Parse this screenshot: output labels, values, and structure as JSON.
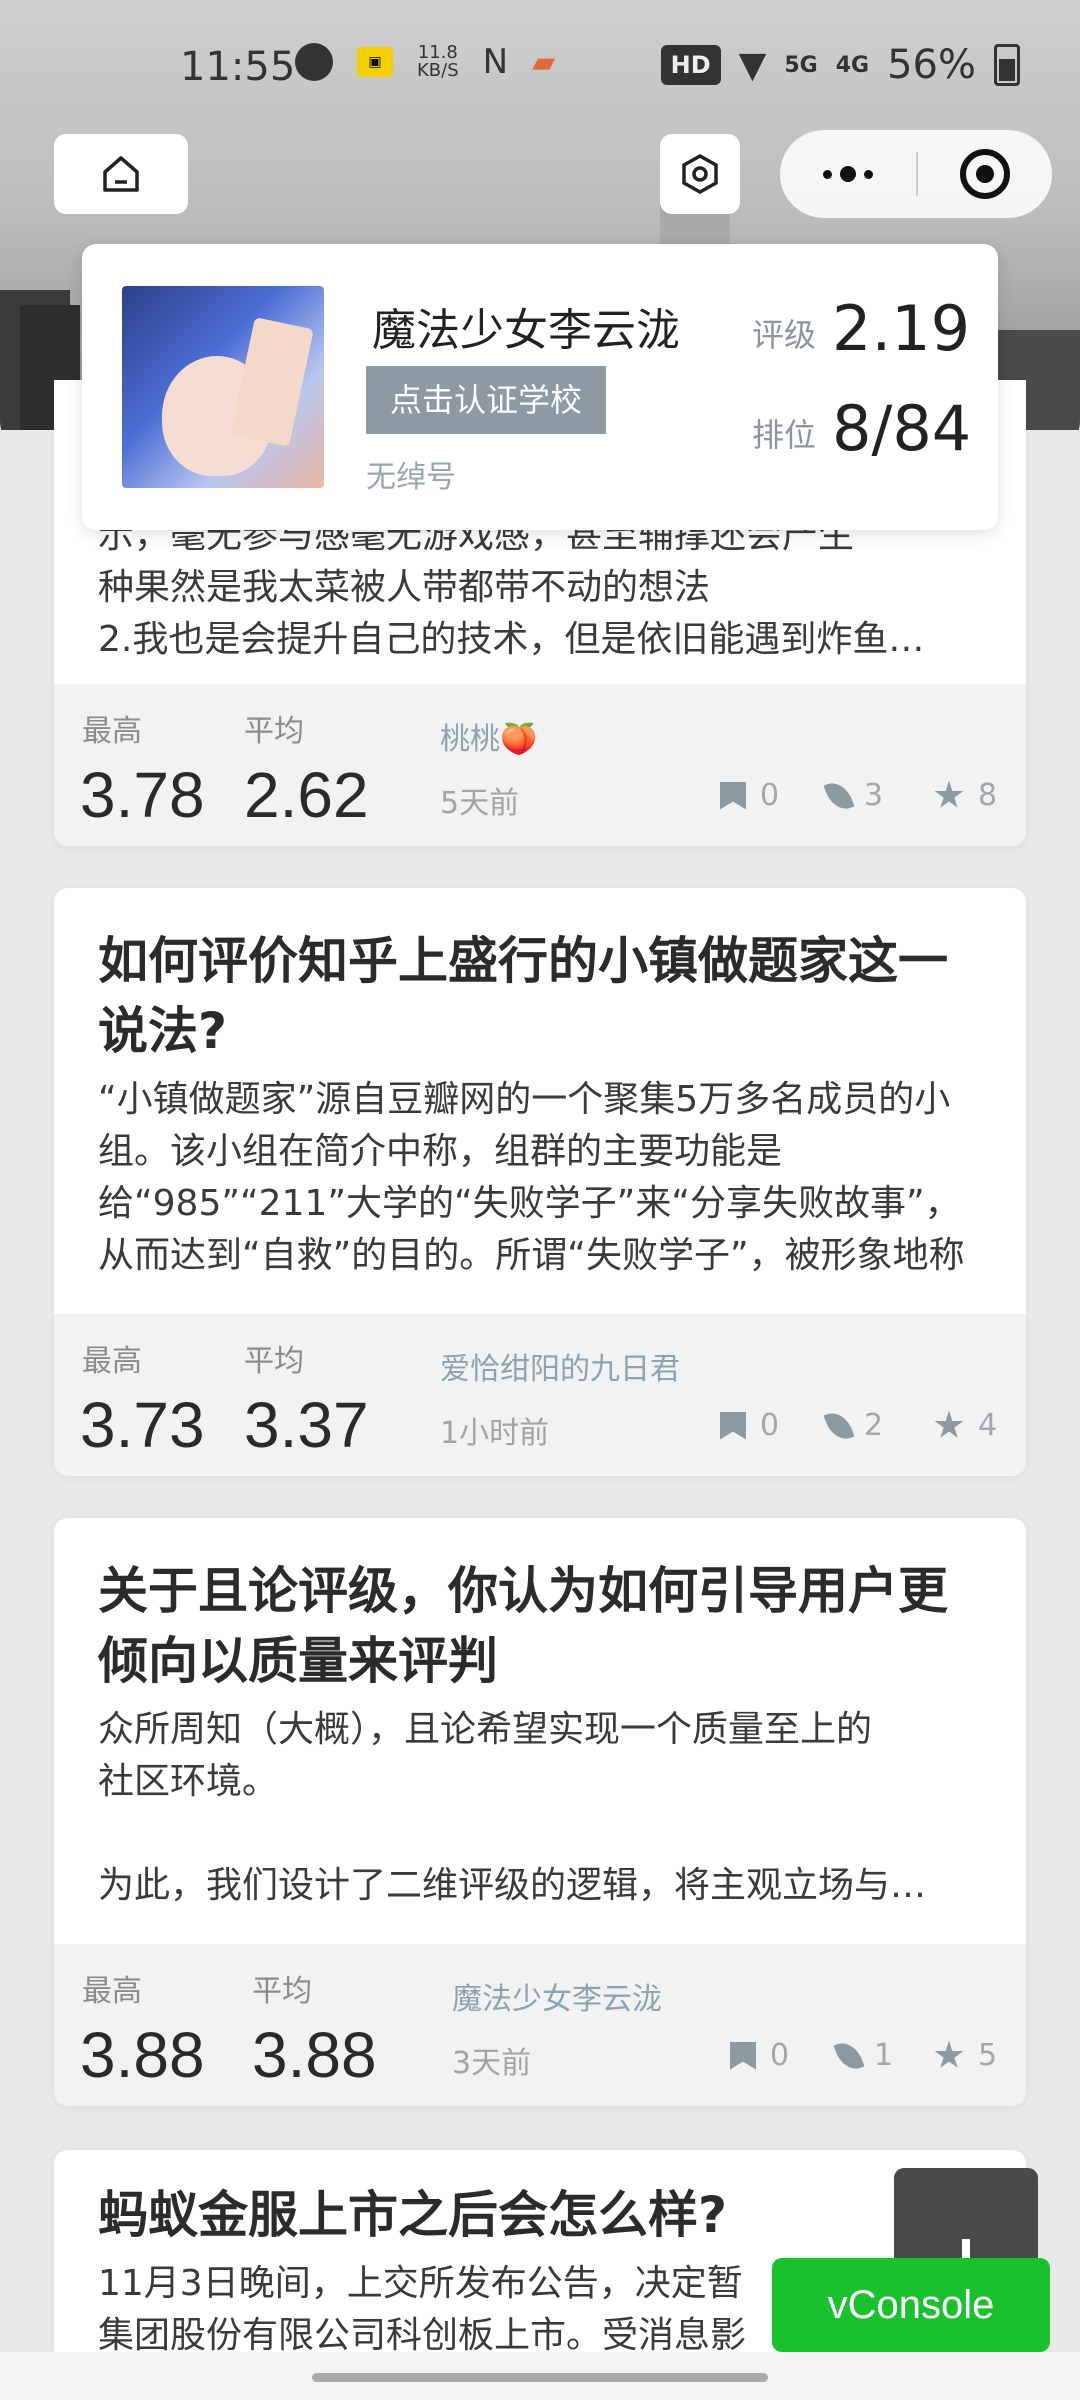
{
  "status_bar": {
    "time": "11:55",
    "net_speed_value": "11.8",
    "net_speed_unit": "KB/S",
    "hd_label": "HD",
    "signal_5g": "5G",
    "signal_4g": "4G",
    "battery": "56%"
  },
  "profile": {
    "name": "魔法少女李云泷",
    "verify_button": "点击认证学校",
    "subtitle": "无绰号",
    "rating_label": "评级",
    "rating_value": "2.19",
    "rank_label": "排位",
    "rank_value": "8/84"
  },
  "posts": [
    {
      "title": "",
      "excerpt": "示，毫无参与感毫无游戏感，甚至辅撑还会产生\n种果然是我太菜被人带都带不动的想法\n2.我也是会提升自己的技术，但是依旧能遇到炸鱼…",
      "max_label": "最高",
      "max_value": "3.78",
      "avg_label": "平均",
      "avg_value": "2.62",
      "author": "桃桃🍑",
      "time": "5天前",
      "bookmarks": "0",
      "comments": "3",
      "ratings": "8"
    },
    {
      "title": "如何评价知乎上盛行的小镇做题家这一说法?",
      "excerpt": "“小镇做题家”源自豆瓣网的一个聚集5万多名成员的小组。该小组在简介中称，组群的主要功能是给“985”“211”大学的“失败学子”来“分享失败故事”，从而达到“自救”的目的。所谓“失败学子”，被形象地称为“…",
      "max_label": "最高",
      "max_value": "3.73",
      "avg_label": "平均",
      "avg_value": "3.37",
      "author": "爱恰绀阳的九日君",
      "time": "1小时前",
      "bookmarks": "0",
      "comments": "2",
      "ratings": "4"
    },
    {
      "title": "关于且论评级，你认为如何引导用户更倾向以质量来评判",
      "excerpt": "众所周知（大概），且论希望实现一个质量至上的\n社区环境。\n\n为此，我们设计了二维评级的逻辑，将主观立场与…",
      "max_label": "最高",
      "max_value": "3.88",
      "avg_label": "平均",
      "avg_value": "3.88",
      "author": "魔法少女李云泷",
      "time": "3天前",
      "bookmarks": "0",
      "comments": "1",
      "ratings": "5"
    },
    {
      "title": "蚂蚁金服上市之后会怎么样?",
      "excerpt": "11月3日晚间，上交所发布公告，决定暂\n集团股份有限公司科创板上市。受消息影"
    }
  ],
  "vconsole_label": "vConsole",
  "icons": {
    "home": "home-icon",
    "settings": "hexagon-settings-icon",
    "more": "more-dots-icon",
    "close": "target-close-icon",
    "bookmark": "bookmark-icon",
    "comment": "feather-icon",
    "rating": "star-icon",
    "add": "plus-icon"
  }
}
